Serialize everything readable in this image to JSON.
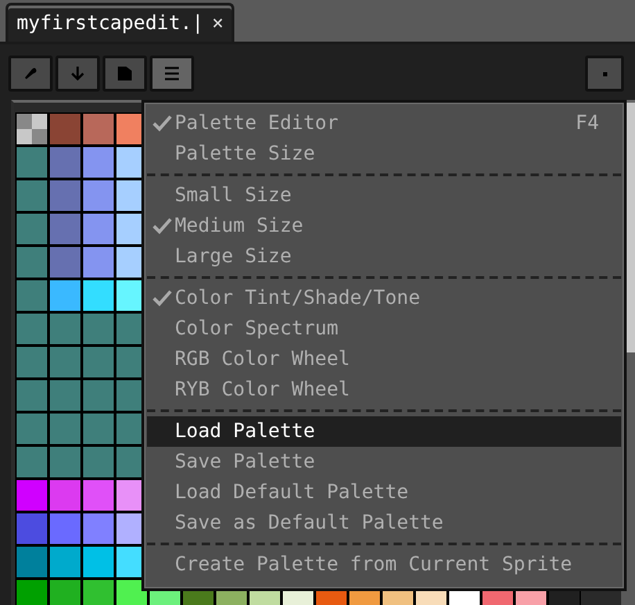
{
  "tabs": [
    {
      "label": "myfirstcapedit.|",
      "close": "×",
      "selected": true
    }
  ],
  "palette": {
    "rows": [
      {
        "swatches": [
          {
            "kind": "transparent"
          },
          {
            "color": "#8a4434"
          },
          {
            "color": "#b8685a"
          },
          {
            "color": "#f08060"
          }
        ]
      },
      {
        "swatches": [
          {
            "color": "#3f7f7b"
          },
          {
            "color": "#6670b0"
          },
          {
            "color": "#8494f0"
          },
          {
            "color": "#a6cfff"
          }
        ]
      },
      {
        "swatches": [
          {
            "color": "#3f7f7b"
          },
          {
            "color": "#6670b0"
          },
          {
            "color": "#8494f0"
          },
          {
            "color": "#a6cfff"
          }
        ]
      },
      {
        "swatches": [
          {
            "color": "#3f7f7b"
          },
          {
            "color": "#6670b0"
          },
          {
            "color": "#8494f0"
          },
          {
            "color": "#a6cfff"
          }
        ]
      },
      {
        "swatches": [
          {
            "color": "#3f7f7b"
          },
          {
            "color": "#6670b0"
          },
          {
            "color": "#8494f0"
          },
          {
            "color": "#a6cfff"
          }
        ]
      },
      {
        "swatches": [
          {
            "color": "#3f7f7b"
          },
          {
            "color": "#3ab9ff"
          },
          {
            "color": "#33ddff"
          },
          {
            "color": "#66f5ff"
          }
        ]
      },
      {
        "swatches": [
          {
            "color": "#3f7f7b"
          },
          {
            "color": "#3f7f7b"
          },
          {
            "color": "#3f7f7b"
          },
          {
            "color": "#3f7f7b"
          }
        ]
      },
      {
        "swatches": [
          {
            "color": "#3f7f7b"
          },
          {
            "color": "#3f7f7b"
          },
          {
            "color": "#3f7f7b"
          },
          {
            "color": "#3f7f7b"
          }
        ]
      },
      {
        "swatches": [
          {
            "color": "#3f7f7b"
          },
          {
            "color": "#3f7f7b"
          },
          {
            "color": "#3f7f7b"
          },
          {
            "color": "#3f7f7b"
          }
        ]
      },
      {
        "swatches": [
          {
            "color": "#3f7f7b"
          },
          {
            "color": "#3f7f7b"
          },
          {
            "color": "#3f7f7b"
          },
          {
            "color": "#3f7f7b"
          }
        ]
      },
      {
        "swatches": [
          {
            "color": "#3f7f7b"
          },
          {
            "color": "#3f7f7b"
          },
          {
            "color": "#3f7f7b"
          },
          {
            "color": "#3f7f7b"
          }
        ]
      },
      {
        "swatches": [
          {
            "color": "#d000ff"
          },
          {
            "color": "#dc3af0"
          },
          {
            "color": "#e050f8"
          },
          {
            "color": "#e890f8"
          }
        ]
      },
      {
        "swatches": [
          {
            "color": "#4c4ce0"
          },
          {
            "color": "#6a6aff"
          },
          {
            "color": "#8080ff"
          },
          {
            "color": "#b0b0ff"
          }
        ]
      },
      {
        "swatches": [
          {
            "color": "#00809c"
          },
          {
            "color": "#00aacc"
          },
          {
            "color": "#00c0e6"
          },
          {
            "color": "#44ddff"
          }
        ]
      },
      {
        "swatches": [
          {
            "color": "#00a000"
          },
          {
            "color": "#20b020"
          },
          {
            "color": "#30c030"
          },
          {
            "color": "#50f050"
          },
          {
            "color": "#6cf07c"
          },
          {
            "color": "#4a7a1c"
          },
          {
            "color": "#8cb060"
          },
          {
            "color": "#c0dca0"
          },
          {
            "color": "#e8f0d8"
          },
          {
            "color": "#e85a10"
          },
          {
            "color": "#f09a40"
          },
          {
            "color": "#f0c080"
          },
          {
            "color": "#f8dcb8"
          },
          {
            "color": "#ffffff"
          },
          {
            "color": "#f06870"
          },
          {
            "color": "#f8a0a8"
          },
          {
            "color": "#202020"
          }
        ]
      }
    ]
  },
  "menu": {
    "items": [
      {
        "kind": "item",
        "label": "Palette Editor",
        "shortcut": "F4",
        "checked": true,
        "selected": false
      },
      {
        "kind": "item",
        "label": "Palette Size",
        "checked": false,
        "selected": false
      },
      {
        "kind": "separator"
      },
      {
        "kind": "item",
        "label": "Small Size",
        "checked": false,
        "selected": false
      },
      {
        "kind": "item",
        "label": "Medium Size",
        "checked": true,
        "selected": false
      },
      {
        "kind": "item",
        "label": "Large Size",
        "checked": false,
        "selected": false
      },
      {
        "kind": "separator"
      },
      {
        "kind": "item",
        "label": "Color Tint/Shade/Tone",
        "checked": true,
        "selected": false
      },
      {
        "kind": "item",
        "label": "Color Spectrum",
        "checked": false,
        "selected": false
      },
      {
        "kind": "item",
        "label": "RGB Color Wheel",
        "checked": false,
        "selected": false
      },
      {
        "kind": "item",
        "label": "RYB Color Wheel",
        "checked": false,
        "selected": false
      },
      {
        "kind": "separator"
      },
      {
        "kind": "item",
        "label": "Load Palette",
        "checked": false,
        "selected": true
      },
      {
        "kind": "item",
        "label": "Save Palette",
        "checked": false,
        "selected": false
      },
      {
        "kind": "item",
        "label": "Load Default Palette",
        "checked": false,
        "selected": false
      },
      {
        "kind": "item",
        "label": "Save as Default Palette",
        "checked": false,
        "selected": false
      },
      {
        "kind": "separator"
      },
      {
        "kind": "item",
        "label": "Create Palette from Current Sprite",
        "checked": false,
        "selected": false
      }
    ]
  }
}
